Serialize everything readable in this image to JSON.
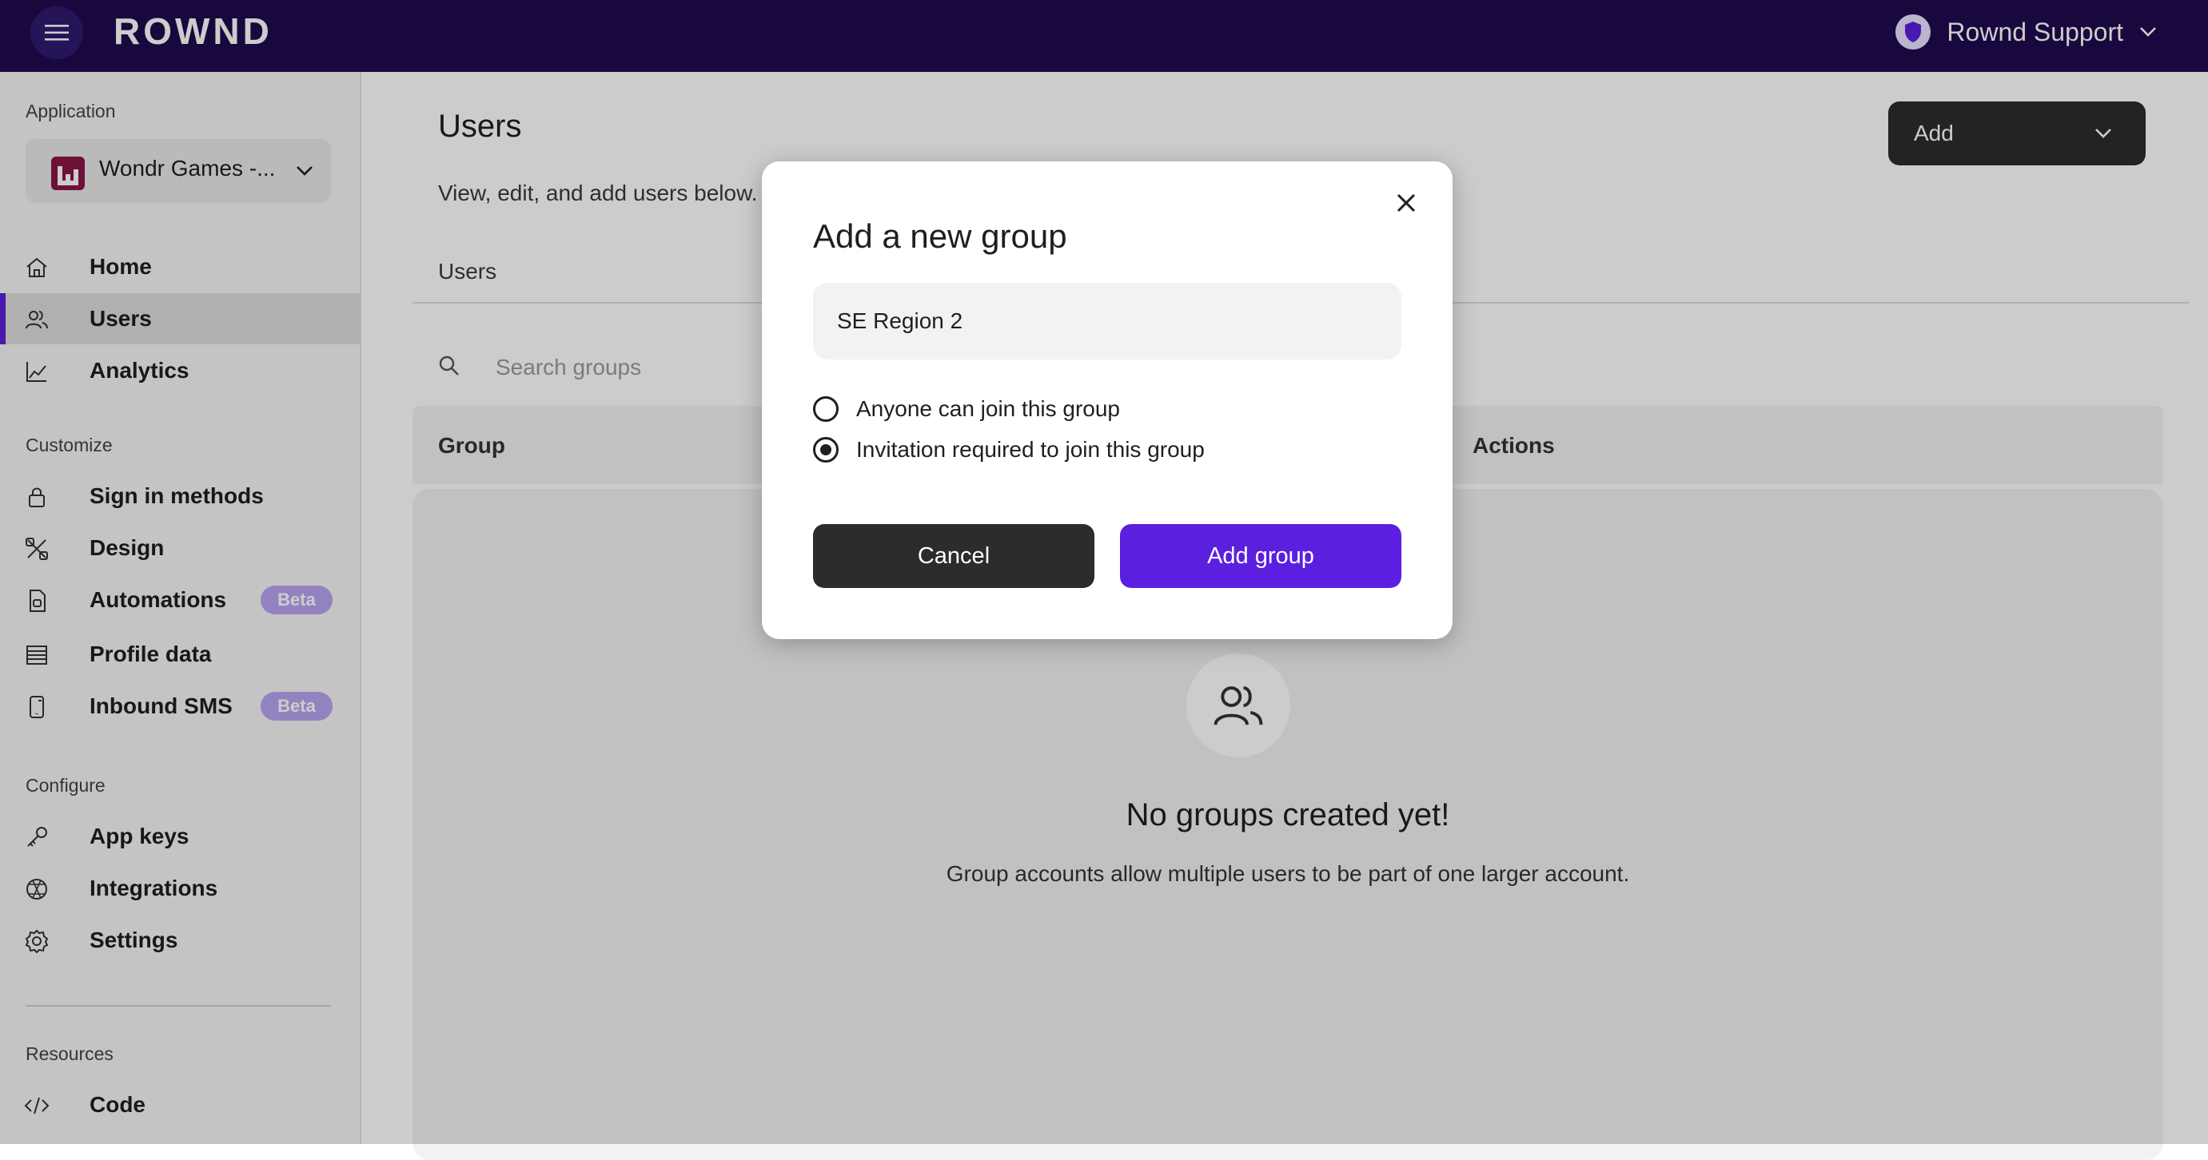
{
  "topbar": {
    "logo": "ROWND",
    "account": "Rownd Support"
  },
  "sidebar": {
    "application_label": "Application",
    "app_name": "Wondr Games -...",
    "sections": {
      "customize": "Customize",
      "configure": "Configure",
      "resources": "Resources"
    },
    "items": [
      {
        "label": "Home",
        "icon": "home-icon"
      },
      {
        "label": "Users",
        "icon": "users-icon",
        "active": true
      },
      {
        "label": "Analytics",
        "icon": "chart-icon"
      },
      {
        "label": "Sign in methods",
        "icon": "lock-icon"
      },
      {
        "label": "Design",
        "icon": "design-icon"
      },
      {
        "label": "Automations",
        "icon": "automation-icon",
        "badge": "Beta"
      },
      {
        "label": "Profile data",
        "icon": "list-icon"
      },
      {
        "label": "Inbound SMS",
        "icon": "sms-icon",
        "badge": "Beta"
      },
      {
        "label": "App keys",
        "icon": "key-icon"
      },
      {
        "label": "Integrations",
        "icon": "integrations-icon"
      },
      {
        "label": "Settings",
        "icon": "gear-icon"
      },
      {
        "label": "Code",
        "icon": "code-icon"
      }
    ]
  },
  "main": {
    "title": "Users",
    "description": "View, edit, and add users below. T",
    "add_button": "Add",
    "tab": "Users",
    "search_placeholder": "Search groups",
    "columns": {
      "group": "Group",
      "actions": "Actions"
    },
    "empty_title": "No groups created yet!",
    "empty_desc": "Group accounts allow multiple users to be part of one larger account."
  },
  "modal": {
    "title": "Add a new group",
    "group_name_value": "SE Region 2",
    "options": [
      {
        "label": "Anyone can join this group",
        "selected": false
      },
      {
        "label": "Invitation required to join this group",
        "selected": true
      }
    ],
    "cancel": "Cancel",
    "submit": "Add group"
  },
  "colors": {
    "topbar": "#1e0b4e",
    "accent": "#5b1fe0",
    "dark_button": "#2c2c2c",
    "beta_badge": "#b7a4f0"
  }
}
